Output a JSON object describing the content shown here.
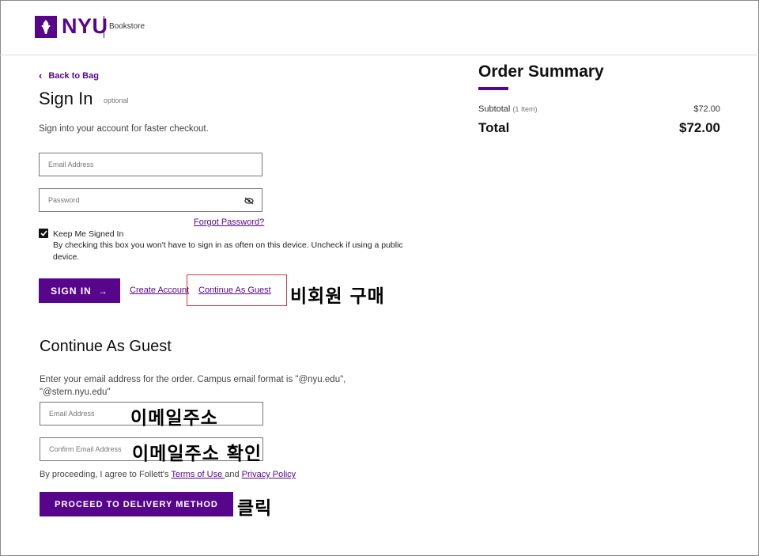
{
  "header": {
    "logo_text": "NYU",
    "logo_sub": "Bookstore"
  },
  "signin": {
    "back_label": "Back to Bag",
    "title": "Sign In",
    "optional": "optional",
    "description": "Sign into your account for faster checkout.",
    "email_placeholder": "Email Address",
    "password_placeholder": "Password",
    "forgot_label": "Forgot Password?",
    "keep_label": "Keep Me Signed In",
    "keep_desc": "By checking this box you won't have to sign in as often on this device. Uncheck if using a public device.",
    "signin_button": "SIGN IN",
    "create_account": "Create Account",
    "continue_guest": "Continue As Guest"
  },
  "guest": {
    "title": "Continue As Guest",
    "description": "Enter your email address for the order. Campus email format is \"@nyu.edu\", \"@stern.nyu.edu\"",
    "email_placeholder": "Email Address",
    "confirm_placeholder": "Confirm Email Address",
    "agree_prefix": "By proceeding, I agree to Follett's ",
    "terms_label": "Terms of Use ",
    "and_text": "and ",
    "privacy_label": "Privacy Policy",
    "proceed_button": "PROCEED TO DELIVERY METHOD"
  },
  "summary": {
    "title": "Order Summary",
    "subtotal_label": "Subtotal",
    "subtotal_count": "(1 Item)",
    "subtotal_value": "$72.00",
    "total_label": "Total",
    "total_value": "$72.00"
  },
  "annotations": {
    "guest_purchase": "비회원 구매",
    "email": "이메일주소",
    "confirm_email": "이메일주소 확인",
    "click": "클릭"
  },
  "colors": {
    "brand": "#57068c",
    "highlight": "#d23a3a"
  }
}
